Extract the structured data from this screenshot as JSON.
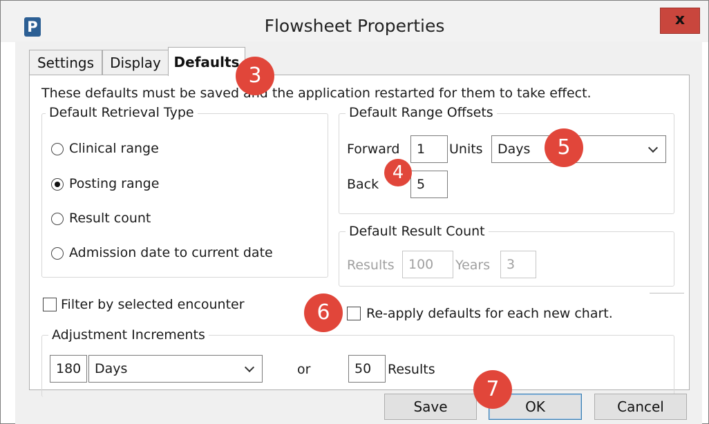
{
  "window": {
    "title": "Flowsheet Properties",
    "app_icon_letter": "P",
    "close_glyph": "x",
    "accent_color": "#2c5f94",
    "close_color": "#c9463d"
  },
  "tabs": [
    {
      "label": "Settings",
      "active": false
    },
    {
      "label": "Display",
      "active": false
    },
    {
      "label": "Defaults",
      "active": true
    }
  ],
  "notice": "These defaults must be saved and the application restarted for them to take effect.",
  "retrieval": {
    "legend": "Default Retrieval Type",
    "options": [
      {
        "label": "Clinical range",
        "checked": false
      },
      {
        "label": "Posting range",
        "checked": true
      },
      {
        "label": "Result count",
        "checked": false
      },
      {
        "label": "Admission date to current date",
        "checked": false
      }
    ]
  },
  "range_offsets": {
    "legend": "Default Range Offsets",
    "forward_label": "Forward",
    "forward_value": "1",
    "units_label": "Units",
    "units_value": "Days",
    "back_label": "Back",
    "back_value": "5"
  },
  "result_count": {
    "legend": "Default Result Count",
    "results_label": "Results",
    "results_value": "100",
    "years_label": "Years",
    "years_value": "3"
  },
  "filter_encounter": {
    "label": "Filter by selected encounter",
    "checked": false
  },
  "reapply_defaults": {
    "label": "Re-apply defaults for each new chart.",
    "checked": false
  },
  "adjustment": {
    "legend": "Adjustment Increments",
    "amount_value": "180",
    "unit_value": "Days",
    "or_label": "or",
    "results_value": "50",
    "results_label": "Results"
  },
  "buttons": {
    "save": "Save",
    "ok": "OK",
    "cancel": "Cancel"
  },
  "callouts": {
    "c3": "3",
    "c4": "4",
    "c5": "5",
    "c6": "6",
    "c7": "7",
    "color": "#e1463a"
  }
}
